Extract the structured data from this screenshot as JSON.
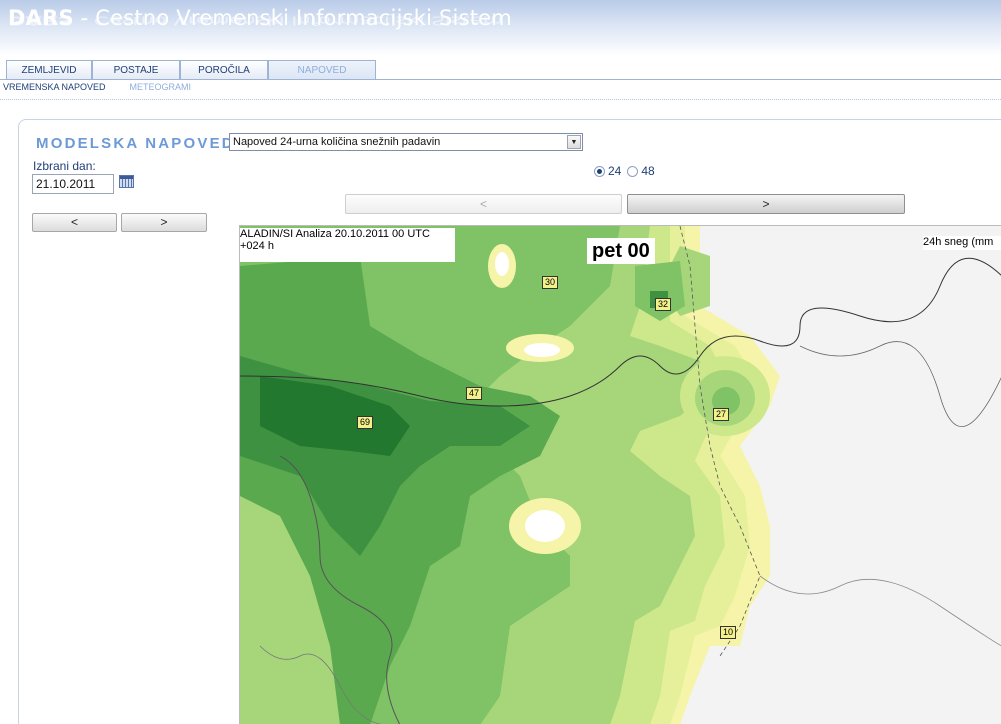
{
  "header": {
    "brand": "DARS",
    "title": " - Cestno Vremenski Informacijski Sistem"
  },
  "tabs": [
    {
      "label": "ZEMLJEVID",
      "active": false
    },
    {
      "label": "POSTAJE",
      "active": false
    },
    {
      "label": "POROČILA",
      "active": false
    },
    {
      "label": "NAPOVED",
      "active": true
    }
  ],
  "subnav": [
    {
      "label": "VREMENSKA NAPOVED",
      "active": false
    },
    {
      "label": "METEOGRAMI",
      "active": true
    }
  ],
  "main": {
    "title": "MODELSKA NAPOVED:",
    "select_value": "Napoved 24-urna količina snežnih padavin",
    "date_label": "Izbrani dan:",
    "date_value": "21.10.2011",
    "prev_day": "<",
    "next_day": ">",
    "radio_24": "24",
    "radio_48": "48",
    "radio_selected": "24",
    "prev_page": "<",
    "next_page": ">"
  },
  "map": {
    "model_label": "ALADIN/SI Analiza 20.10.2011 00 UTC",
    "lead_label": "+024 h",
    "day_label": "pet 00",
    "unit_label": "24h sneg (mm",
    "values": [
      "30",
      "32",
      "47",
      "69",
      "27",
      "10"
    ],
    "colors": {
      "lightest": "#f5f4a8",
      "light_yellow": "#e6f09a",
      "yellow_green": "#cde88a",
      "light_green": "#a7d67a",
      "green": "#80c266",
      "mid_green": "#5aa94f",
      "dark_green": "#3d9140",
      "darkest_green": "#22782e",
      "land": "#f3f3f3"
    }
  },
  "colors": {
    "accent": "#6d9ad6",
    "nav_text": "#1f3f78"
  }
}
